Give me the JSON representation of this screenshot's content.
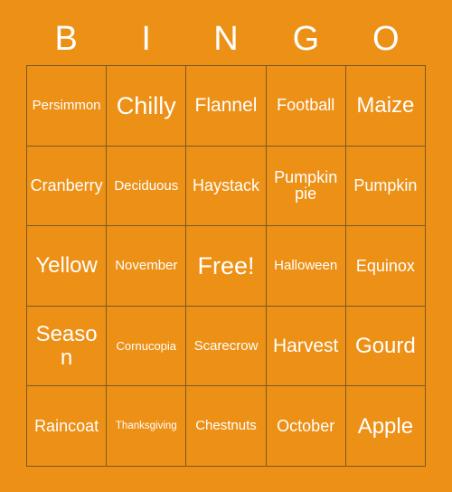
{
  "card": {
    "title_letters": [
      "B",
      "I",
      "N",
      "G",
      "O"
    ],
    "background_color": "#ed9016",
    "text_color": "#ffffff",
    "border_color": "#7a5a20",
    "rows": [
      [
        {
          "label": "Persimmon",
          "size": "sm"
        },
        {
          "label": "Chilly",
          "size": "xxl"
        },
        {
          "label": "Flannel",
          "size": "lg"
        },
        {
          "label": "Football",
          "size": "md"
        },
        {
          "label": "Maize",
          "size": "xl"
        }
      ],
      [
        {
          "label": "Cranberry",
          "size": "md"
        },
        {
          "label": "Deciduous",
          "size": "sm"
        },
        {
          "label": "Haystack",
          "size": "md"
        },
        {
          "label": "Pumpkin pie",
          "size": "md"
        },
        {
          "label": "Pumpkin",
          "size": "md"
        }
      ],
      [
        {
          "label": "Yellow",
          "size": "xl"
        },
        {
          "label": "November",
          "size": "sm"
        },
        {
          "label": "Free!",
          "size": "xxl"
        },
        {
          "label": "Halloween",
          "size": "sm"
        },
        {
          "label": "Equinox",
          "size": "md"
        }
      ],
      [
        {
          "label": "Season",
          "size": "xl"
        },
        {
          "label": "Cornucopia",
          "size": "xs"
        },
        {
          "label": "Scarecrow",
          "size": "sm"
        },
        {
          "label": "Harvest",
          "size": "lg"
        },
        {
          "label": "Gourd",
          "size": "xl"
        }
      ],
      [
        {
          "label": "Raincoat",
          "size": "md"
        },
        {
          "label": "Thanksgiving",
          "size": "xxs"
        },
        {
          "label": "Chestnuts",
          "size": "sm"
        },
        {
          "label": "October",
          "size": "md"
        },
        {
          "label": "Apple",
          "size": "xl"
        }
      ]
    ]
  }
}
